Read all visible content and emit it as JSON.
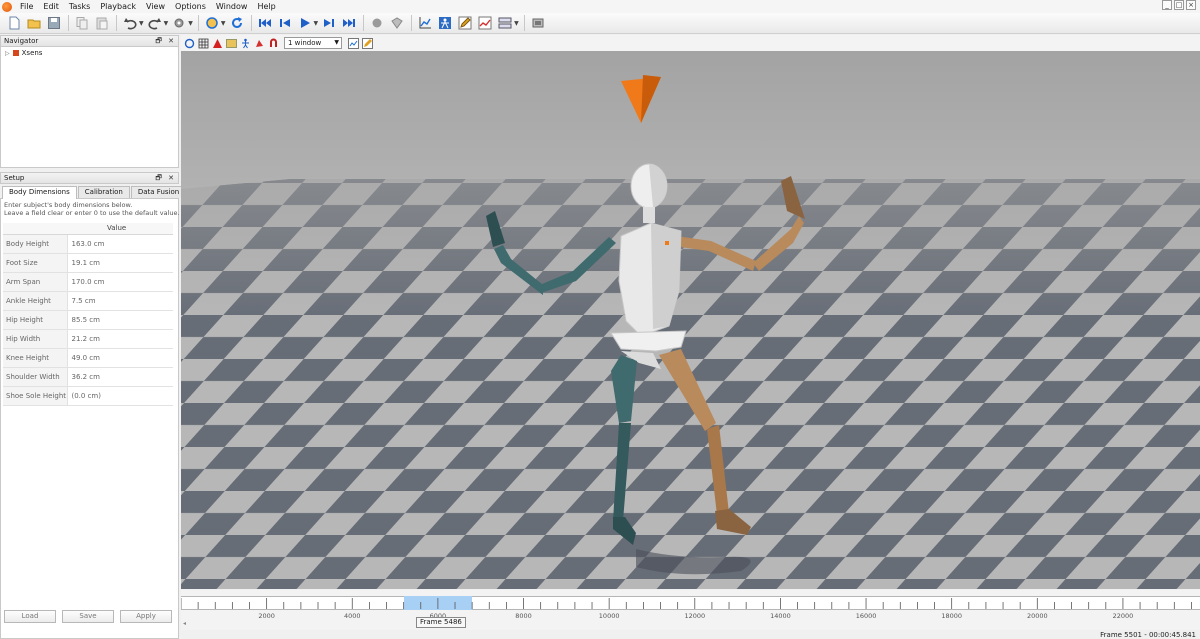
{
  "menu": [
    "File",
    "Edit",
    "Tasks",
    "Playback",
    "View",
    "Options",
    "Window",
    "Help"
  ],
  "window_controls": [
    "_",
    "□",
    "×"
  ],
  "toolbar": {
    "icons": [
      "new-file-icon",
      "open-folder-icon",
      "save-icon",
      "copy-icon",
      "paste-icon",
      "undo-icon",
      "redo-icon",
      "settings-icon",
      "reprocess-icon",
      "refresh-icon",
      "skip-start-icon",
      "step-back-icon",
      "play-icon",
      "step-forward-icon",
      "skip-end-icon",
      "record-icon",
      "marker-icon",
      "graph-icon",
      "person-icon",
      "pencil-icon",
      "chart-icon",
      "layout-icon",
      "screenshot-icon"
    ]
  },
  "navigator": {
    "title": "Navigator",
    "panel_buttons": "🗗 ✕",
    "item": "Xsens"
  },
  "setup": {
    "title": "Setup",
    "panel_buttons": "🗗 ✕",
    "tabs": [
      "Body Dimensions",
      "Calibration",
      "Data Fusion"
    ],
    "description_1": "Enter subject's body dimensions below.",
    "description_2": "Leave a field clear or enter 0 to use the default value.",
    "column_header": "Value",
    "rows": [
      {
        "label": "Body Height",
        "value": "163.0 cm"
      },
      {
        "label": "Foot Size",
        "value": "19.1 cm"
      },
      {
        "label": "Arm Span",
        "value": "170.0 cm"
      },
      {
        "label": "Ankle Height",
        "value": "7.5 cm"
      },
      {
        "label": "Hip Height",
        "value": "85.5 cm"
      },
      {
        "label": "Hip Width",
        "value": "21.2 cm"
      },
      {
        "label": "Knee Height",
        "value": "49.0 cm"
      },
      {
        "label": "Shoulder Width",
        "value": "36.2 cm"
      },
      {
        "label": "Shoe Sole Height",
        "value": "(0.0 cm)"
      }
    ],
    "buttons": {
      "load": "Load",
      "save": "Save",
      "apply": "Apply"
    }
  },
  "viewport_toolbar": {
    "window_select": "1 window"
  },
  "timeline": {
    "labels": [
      "2000",
      "4000",
      "6000",
      "8000",
      "10000",
      "12000",
      "14000",
      "16000",
      "18000",
      "20000",
      "22000"
    ],
    "frame_tooltip": "Frame 5486",
    "selection_start": 5200,
    "selection_end": 6800,
    "max_frame": 23800
  },
  "status": "Frame 5501 - 00:00:45.841",
  "colors": {
    "accent_orange": "#f07a1a",
    "left_limb": "#3f6a6e",
    "right_limb": "#b88a5c",
    "torso": "#e8e8e8"
  }
}
